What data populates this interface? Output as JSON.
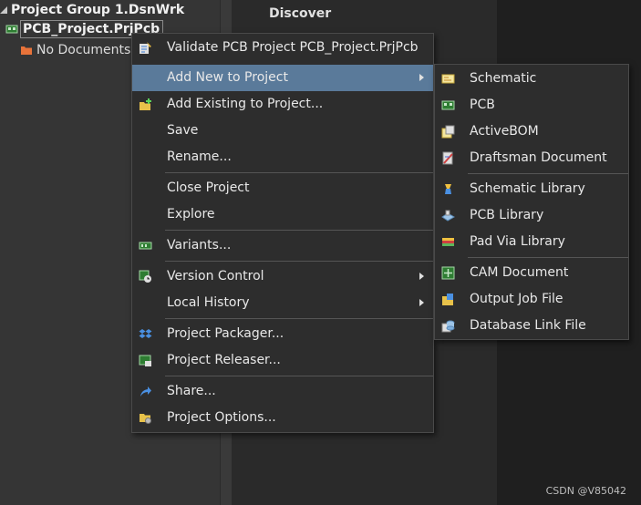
{
  "tree": {
    "group": "Project Group 1.DsnWrk",
    "project": "PCB_Project.PrjPcb",
    "nodocs": "No Documents A"
  },
  "discover": "Discover",
  "watermark": "CSDN @V85042",
  "main_menu": {
    "validate": "Validate PCB Project PCB_Project.PrjPcb",
    "add_new": "Add New to Project",
    "add_existing": "Add Existing to Project...",
    "save": "Save",
    "rename": "Rename...",
    "close_project": "Close Project",
    "explore": "Explore",
    "variants": "Variants...",
    "version_control": "Version Control",
    "local_history": "Local History",
    "packager": "Project Packager...",
    "releaser": "Project Releaser...",
    "share": "Share...",
    "options": "Project Options..."
  },
  "sub_menu": {
    "schematic": "Schematic",
    "pcb": "PCB",
    "activebom": "ActiveBOM",
    "draftsman": "Draftsman Document",
    "schematic_library": "Schematic Library",
    "pcb_library": "PCB Library",
    "pad_via_library": "Pad Via Library",
    "cam_document": "CAM Document",
    "output_job_file": "Output Job File",
    "database_link_file": "Database Link File"
  },
  "colors": {
    "highlight": "#5a7a9a",
    "menu_bg": "#2d2d2d"
  }
}
